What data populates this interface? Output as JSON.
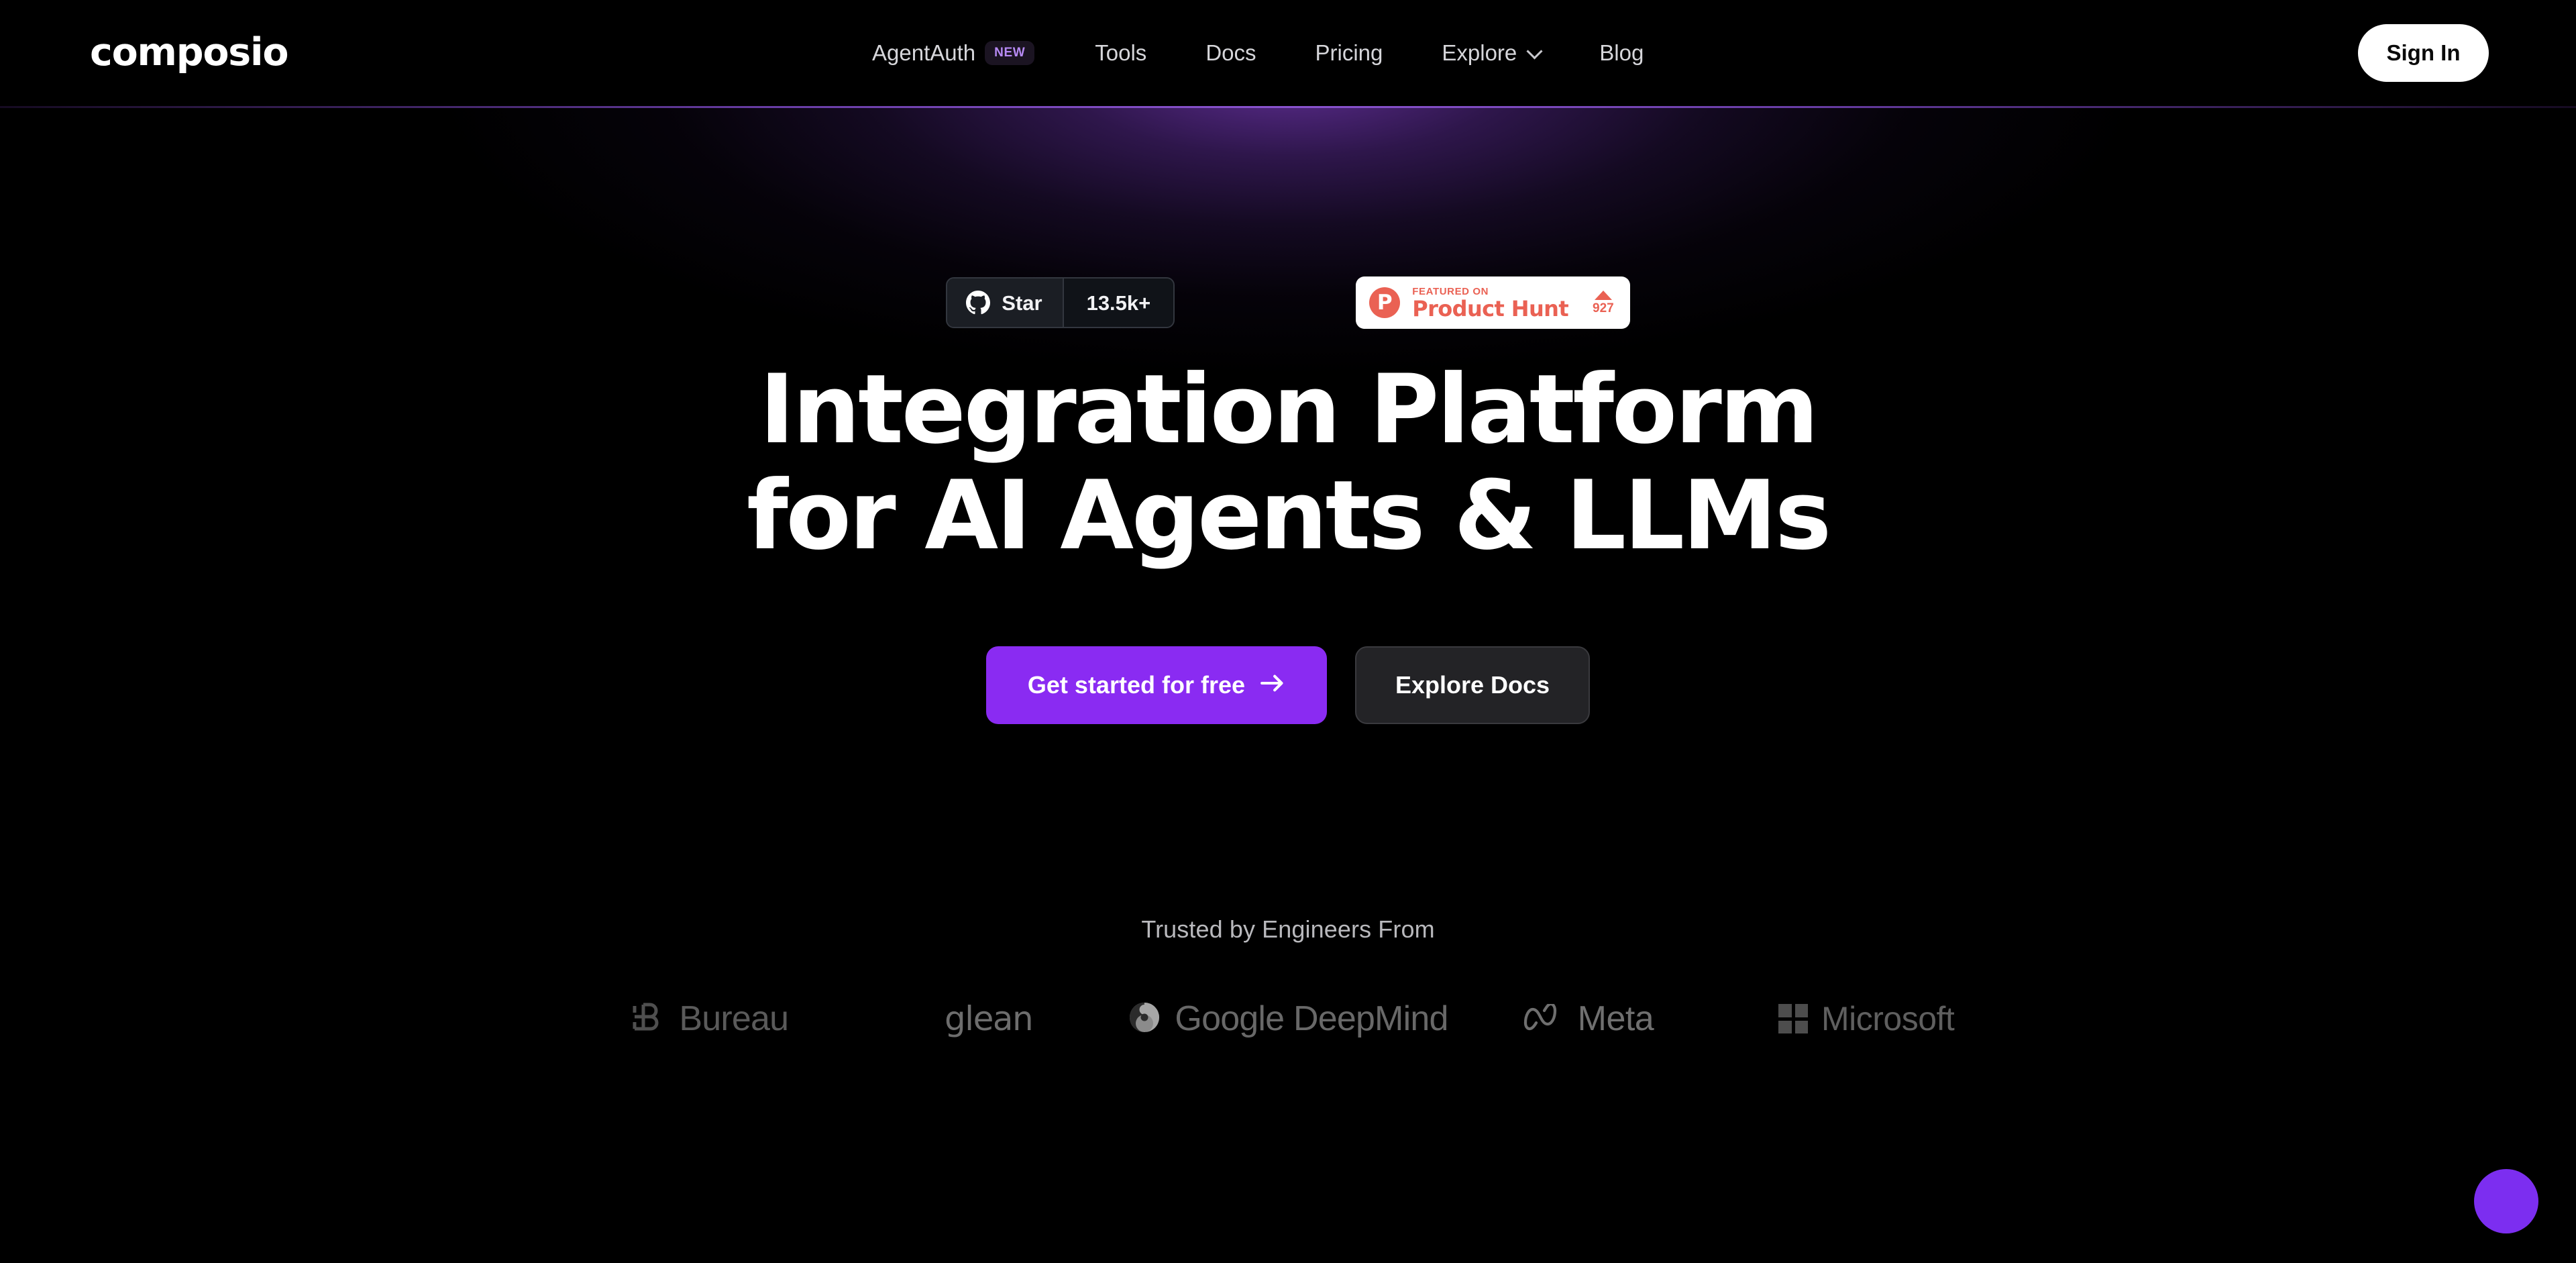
{
  "brand": {
    "logo_text": "composio",
    "accent_purple": "#8a2bf2",
    "accent_purple_light": "#b78af5",
    "product_hunt_coral": "#ea6153"
  },
  "header": {
    "nav": [
      {
        "label": "AgentAuth",
        "badge": "NEW",
        "has_chevron": false
      },
      {
        "label": "Tools",
        "badge": null,
        "has_chevron": false
      },
      {
        "label": "Docs",
        "badge": null,
        "has_chevron": false
      },
      {
        "label": "Pricing",
        "badge": null,
        "has_chevron": false
      },
      {
        "label": "Explore",
        "badge": null,
        "has_chevron": true
      },
      {
        "label": "Blog",
        "badge": null,
        "has_chevron": false
      }
    ],
    "sign_in_label": "Sign In"
  },
  "hero": {
    "github_badge": {
      "icon": "github-icon",
      "star_label": "Star",
      "star_count": "13.5k+"
    },
    "product_hunt_badge": {
      "icon": "product-hunt-icon",
      "logo_letter": "P",
      "featured_label": "FEATURED ON",
      "name": "Product Hunt",
      "upvote_icon": "triangle-up-icon",
      "upvote_count": "927"
    },
    "headline_line1": "Integration Platform",
    "headline_line2": "for AI Agents & LLMs",
    "primary_cta": "Get started for free",
    "primary_cta_icon": "arrow-right-icon",
    "secondary_cta": "Explore Docs"
  },
  "trusted": {
    "label": "Trusted by Engineers From",
    "logos": [
      {
        "name": "Bureau",
        "icon": "bureau-b-mark-icon"
      },
      {
        "name": "glean",
        "icon": null
      },
      {
        "name": "Google DeepMind",
        "icon": "google-deepmind-spiral-icon"
      },
      {
        "name": "Meta",
        "icon": "meta-infinity-icon"
      },
      {
        "name": "Microsoft",
        "icon": "microsoft-grid-icon"
      }
    ]
  },
  "chat_widget": {
    "label": "chat-bubble-icon"
  }
}
